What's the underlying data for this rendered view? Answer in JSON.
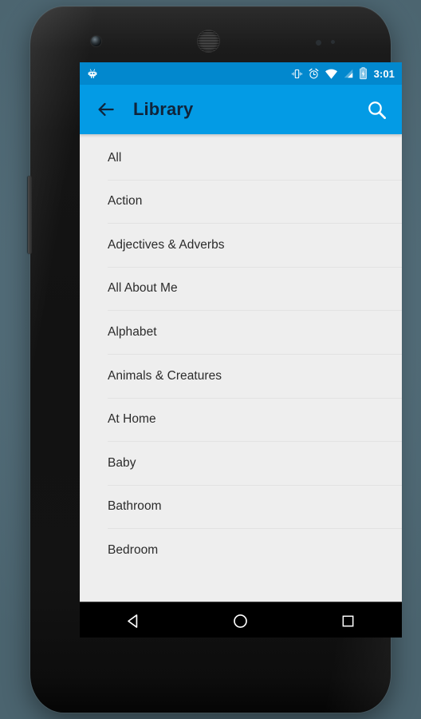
{
  "device": {
    "frame_name": "android-phone-frame",
    "backdrop_color": "#556e7a",
    "body_color": "#141414",
    "hardware": {
      "front_camera": "front-camera",
      "earpiece": "earpiece-speaker",
      "proximity_sensor": "proximity-sensor",
      "light_sensor": "light-sensor",
      "volume_rocker": "volume-rocker",
      "power_button": "power-button"
    }
  },
  "status_bar": {
    "background_color": "#0288ce",
    "foreground_color": "#ffffff",
    "left_icons": [
      {
        "name": "android-robot-icon",
        "label": "Android notification"
      }
    ],
    "right_icons": [
      {
        "name": "vibrate-icon",
        "label": "Vibrate mode"
      },
      {
        "name": "alarm-icon",
        "label": "Alarm set"
      },
      {
        "name": "wifi-icon",
        "label": "Wi-Fi connected"
      },
      {
        "name": "cellular-signal-icon",
        "label": "Cellular signal"
      },
      {
        "name": "battery-charging-icon",
        "label": "Battery charging"
      }
    ],
    "clock": "3:01"
  },
  "action_bar": {
    "background_color": "#039be5",
    "title": "Library",
    "title_color": "#10243a",
    "back_icon": "arrow-left-icon",
    "back_label": "Navigate up",
    "search_icon": "search-icon",
    "search_label": "Search"
  },
  "list": {
    "background_color": "#eeeeee",
    "text_color": "#2b2b2b",
    "divider_color": "#e2e2e2",
    "items": [
      {
        "label": "All"
      },
      {
        "label": "Action"
      },
      {
        "label": "Adjectives & Adverbs"
      },
      {
        "label": "All About Me"
      },
      {
        "label": "Alphabet"
      },
      {
        "label": "Animals & Creatures"
      },
      {
        "label": "At Home"
      },
      {
        "label": "Baby"
      },
      {
        "label": "Bathroom"
      },
      {
        "label": "Bedroom"
      }
    ]
  },
  "nav_bar": {
    "background_color": "#000000",
    "keys": [
      {
        "name": "nav-back-key",
        "icon": "triangle-left-icon",
        "label": "Back"
      },
      {
        "name": "nav-home-key",
        "icon": "circle-icon",
        "label": "Home"
      },
      {
        "name": "nav-recents-key",
        "icon": "square-icon",
        "label": "Recent apps"
      }
    ]
  }
}
